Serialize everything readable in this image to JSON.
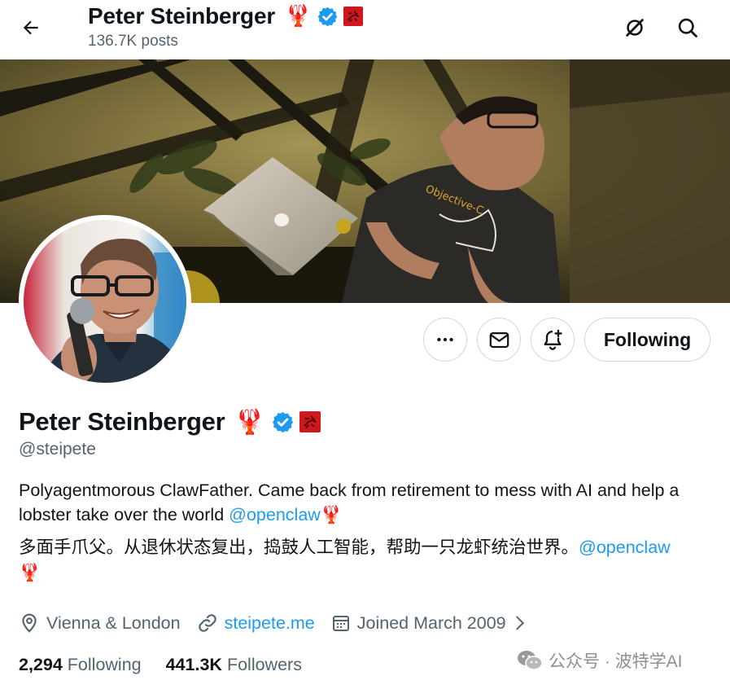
{
  "header": {
    "name": "Peter Steinberger",
    "emoji": "🦞",
    "posts": "136.7K posts"
  },
  "profile": {
    "name": "Peter Steinberger",
    "emoji": "🦞",
    "handle": "@steipete",
    "bio_en_text": "Polyagentmorous ClawFather. Came back from retirement to mess with AI and help a lobster take over the world",
    "bio_en_mention": "@openclaw",
    "bio_en_emoji": "🦞",
    "bio_zh_text": "多面手爪父。从退休状态复出，捣鼓人工智能，帮助一只龙虾统治世界。",
    "bio_zh_mention": "@openclaw",
    "bio_zh_emoji": "🦞",
    "location": "Vienna & London",
    "website": "steipete.me",
    "joined": "Joined March 2009"
  },
  "buttons": {
    "following": "Following"
  },
  "stats": {
    "following_count": "2,294",
    "following_label": "Following",
    "followers_count": "441.3K",
    "followers_label": "Followers"
  },
  "banner_shirt_text": "Objective-C",
  "watermark": "公众号 · 波特学AI",
  "colors": {
    "accent": "#1d9bf0",
    "secondary_text": "#536471",
    "border": "#cfd9de",
    "verified": "#1d9bf0",
    "affiliate_badge": "#d1171e"
  },
  "icons": [
    "back-arrow-icon",
    "grok-icon",
    "search-icon",
    "more-icon",
    "message-icon",
    "notify-icon",
    "verified-icon",
    "location-icon",
    "link-icon",
    "calendar-icon",
    "chevron-right-icon",
    "wechat-icon"
  ]
}
